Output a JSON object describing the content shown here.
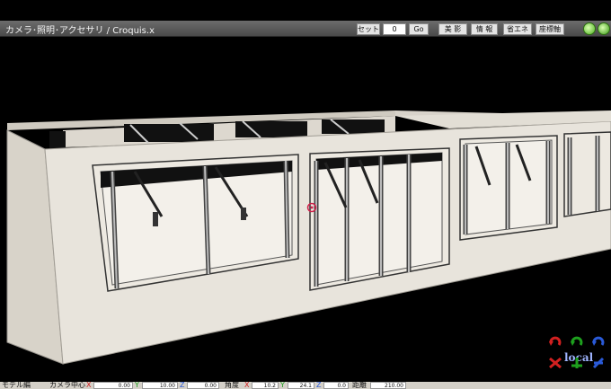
{
  "window": {
    "title": "カメラ･照明･アクセサリ / Croquis.x"
  },
  "toolbar": {
    "set_label": "セット",
    "frame_value": "0",
    "go_label": "Go",
    "beauty_label": "美 影",
    "info_label": "情 報",
    "energy_label": "省エネ",
    "coords_label": "座標軸"
  },
  "viewport": {
    "mode_label": "local",
    "colors": {
      "x_axis": "#d22020",
      "y_axis": "#1ea01e",
      "z_axis": "#2a5ad8",
      "wall": "#e8e4dc"
    }
  },
  "status": {
    "model_tab": "モデル編",
    "camera_center": "カメラ中心",
    "x_label": "X",
    "cx": "0.00",
    "y_label": "Y",
    "cy": "10.00",
    "z_label": "Z",
    "cz": "0.00",
    "angle_label": "角度",
    "ax_label": "X",
    "ax": "10.2",
    "ay_label": "Y",
    "ay": "24.1",
    "az_label": "Z",
    "az": "0.0",
    "distance_label": "距離",
    "dist": "210.00"
  }
}
